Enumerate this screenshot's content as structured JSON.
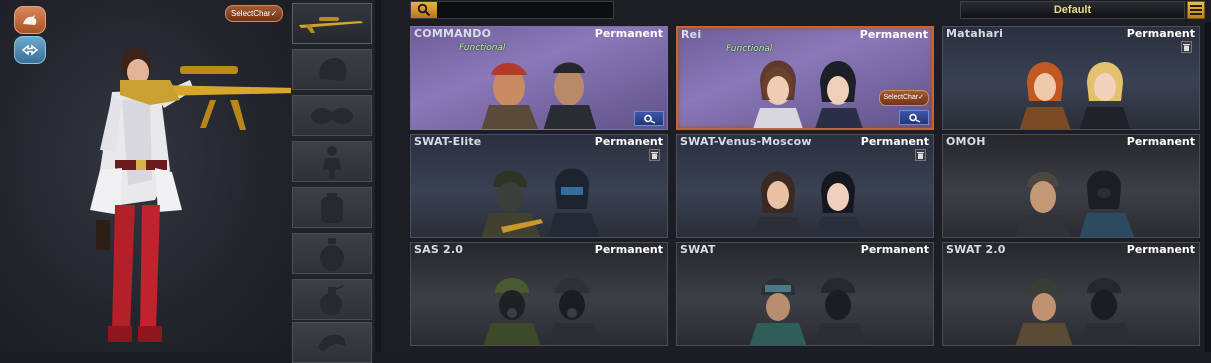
{
  "left_panel": {
    "select_char_label": "SelectChar✓",
    "buttons": [
      {
        "icon": "character-silhouette-icon"
      },
      {
        "icon": "swap-arrows-icon"
      }
    ],
    "accent": "#c86a3c"
  },
  "equipment_slots": [
    {
      "icon": "gold-sniper-rifle-icon",
      "active": true
    },
    {
      "icon": "helmet-slot-icon",
      "active": false
    },
    {
      "icon": "goggles-slot-icon",
      "active": false
    },
    {
      "icon": "character-slot-icon",
      "active": false
    },
    {
      "icon": "backpack-slot-icon",
      "active": false
    },
    {
      "icon": "canteen-slot-icon",
      "active": false
    },
    {
      "icon": "grenade-slot-icon",
      "active": false
    },
    {
      "icon": "emote-slot-icon",
      "active": false
    }
  ],
  "toolbar": {
    "search_placeholder": "",
    "sort_value": "Default",
    "menu_icon": "hamburger-icon"
  },
  "character_cards": [
    {
      "name": "COMMANDO",
      "duration": "Permanent",
      "tag": "Functional",
      "variant": "purple",
      "selected": false,
      "has_settings": true,
      "has_delete": false
    },
    {
      "name": "Rei",
      "duration": "Permanent",
      "tag": "Functional",
      "variant": "purple",
      "selected": true,
      "has_settings": true,
      "has_delete": false,
      "select_label": "SelectChar✓"
    },
    {
      "name": "Matahari",
      "duration": "Permanent",
      "tag": "",
      "variant": "blue",
      "selected": false,
      "has_settings": false,
      "has_delete": true
    },
    {
      "name": "SWAT-Elite",
      "duration": "Permanent",
      "tag": "",
      "variant": "blue",
      "selected": false,
      "has_settings": false,
      "has_delete": true
    },
    {
      "name": "SWAT-Venus-Moscow",
      "duration": "Permanent",
      "tag": "",
      "variant": "blue",
      "selected": false,
      "has_settings": false,
      "has_delete": true
    },
    {
      "name": "OMOH",
      "duration": "Permanent",
      "tag": "",
      "variant": "dark",
      "selected": false,
      "has_settings": false,
      "has_delete": false
    },
    {
      "name": "SAS 2.0",
      "duration": "Permanent",
      "tag": "",
      "variant": "dark",
      "selected": false,
      "has_settings": false,
      "has_delete": false
    },
    {
      "name": "SWAT",
      "duration": "Permanent",
      "tag": "",
      "variant": "dark",
      "selected": false,
      "has_settings": false,
      "has_delete": false
    },
    {
      "name": "SWAT 2.0",
      "duration": "Permanent",
      "tag": "",
      "variant": "dark",
      "selected": false,
      "has_settings": false,
      "has_delete": false
    }
  ],
  "colors": {
    "selected_border": "#c7652e",
    "sort_text": "#f0d98a",
    "search_icon_bg": "#e0a53d",
    "settings_button": "#2f47a0"
  }
}
